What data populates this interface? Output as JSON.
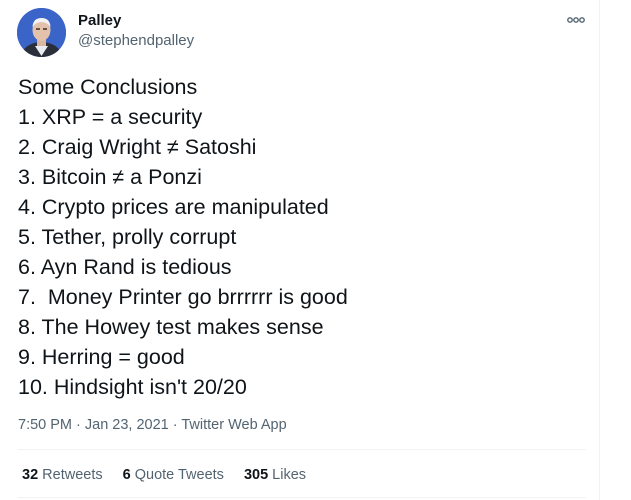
{
  "author": {
    "display_name": "Palley",
    "handle": "@stephendpalley"
  },
  "tweet": {
    "lines": [
      "Some Conclusions",
      "1. XRP = a security",
      "2. Craig Wright ≠ Satoshi",
      "3. Bitcoin ≠ a Ponzi",
      "4. Crypto prices are manipulated",
      "5. Tether, prolly corrupt",
      "6. Ayn Rand is tedious",
      "7.  Money Printer go brrrrrr is good",
      "8. The Howey test makes sense",
      "9. Herring = good",
      "10. Hindsight isn't 20/20"
    ]
  },
  "meta": {
    "time": "7:50 PM",
    "date": "Jan 23, 2021",
    "separator": " · ",
    "source": "Twitter Web App"
  },
  "stats": {
    "retweets_count": "32",
    "retweets_label": "Retweets",
    "quotes_count": "6",
    "quotes_label": "Quote Tweets",
    "likes_count": "305",
    "likes_label": "Likes"
  },
  "icons": {
    "more": "more-horizontal-icon",
    "avatar": "profile-photo"
  },
  "colors": {
    "text_primary": "#0f1419",
    "text_secondary": "#536471",
    "divider": "#eff3f4",
    "avatar_bg": "#3b64c8"
  }
}
